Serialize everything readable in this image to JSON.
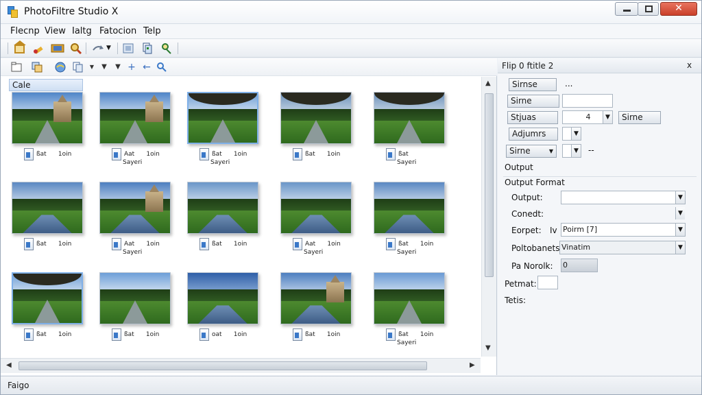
{
  "window": {
    "title": "PhotoFiltre Studio X"
  },
  "menu": [
    "Flecnp",
    "View",
    "Ialtg",
    "Fatocion",
    "Telp"
  ],
  "left_pane": {
    "category_label": "Cale",
    "thumbnails": [
      {
        "row": 0,
        "col": 0,
        "scene": "castle",
        "caption1": "ßat      1oin",
        "caption2": "",
        "selected": false
      },
      {
        "row": 0,
        "col": 1,
        "scene": "castle-road",
        "caption1": "Aat      1oin",
        "caption2": "Sayeri",
        "selected": false
      },
      {
        "row": 0,
        "col": 2,
        "scene": "arch",
        "caption1": "ßat      1oin",
        "caption2": "Sayeri",
        "selected": true
      },
      {
        "row": 0,
        "col": 3,
        "scene": "arch-dark",
        "caption1": "ßat      1oin",
        "caption2": "",
        "selected": false
      },
      {
        "row": 0,
        "col": 4,
        "scene": "arch-dark",
        "caption1": "ßat",
        "caption2": "Sayeri",
        "selected": false
      },
      {
        "row": 1,
        "col": 0,
        "scene": "lake",
        "caption1": "ßat      1oin",
        "caption2": "",
        "selected": false
      },
      {
        "row": 1,
        "col": 1,
        "scene": "castle-lake",
        "caption1": "Aat      1oin",
        "caption2": "Sayeri",
        "selected": false
      },
      {
        "row": 1,
        "col": 2,
        "scene": "lake-wide",
        "caption1": "ßat      1oin",
        "caption2": "",
        "selected": false
      },
      {
        "row": 1,
        "col": 3,
        "scene": "lake-wide",
        "caption1": "Aat      1oin",
        "caption2": "Sayeri",
        "selected": false
      },
      {
        "row": 1,
        "col": 4,
        "scene": "lake",
        "caption1": "ßat      1oin",
        "caption2": "Sayeri",
        "selected": false
      },
      {
        "row": 2,
        "col": 0,
        "scene": "arch",
        "caption1": "ßat      1oin",
        "caption2": "",
        "selected": true
      },
      {
        "row": 2,
        "col": 1,
        "scene": "road",
        "caption1": "ßat      1oin",
        "caption2": "",
        "selected": false
      },
      {
        "row": 2,
        "col": 2,
        "scene": "canal",
        "caption1": "oat      1oin",
        "caption2": "",
        "selected": false
      },
      {
        "row": 2,
        "col": 3,
        "scene": "castle-lake",
        "caption1": "ßat      1oin",
        "caption2": "",
        "selected": false
      },
      {
        "row": 2,
        "col": 4,
        "scene": "avenue",
        "caption1": "ßat      1oin",
        "caption2": "Sayeri",
        "selected": false
      }
    ]
  },
  "right_pane": {
    "title": "Flip 0 ftitle 2",
    "close_glyph": "x",
    "row1_btn": "Sirnse",
    "row1_dots": "...",
    "row2_btn": "Sirne",
    "row3_btn": "Stjuas",
    "row3_value": "4",
    "row3_btn2": "Sirne",
    "row4_btn": "Adjumrs",
    "row5_btn": "Sirne",
    "row5_dash": "--",
    "output_label": "Output",
    "output_format_label": "Output Format",
    "fields": [
      {
        "label": "Output:",
        "value": ""
      },
      {
        "label": "Conedt:",
        "value": ""
      },
      {
        "label": "Eorpet:",
        "label2": "Iv",
        "value": "Poirm [7]"
      },
      {
        "label": "Poltobanets:",
        "value": "Vinatim"
      }
    ],
    "pa_norok_label": "Pa Norolk:",
    "pa_norok_value": "0",
    "petmat_label": "Petmat:",
    "tetis_label": "Tetis:"
  },
  "status": {
    "text": "Faigo"
  }
}
